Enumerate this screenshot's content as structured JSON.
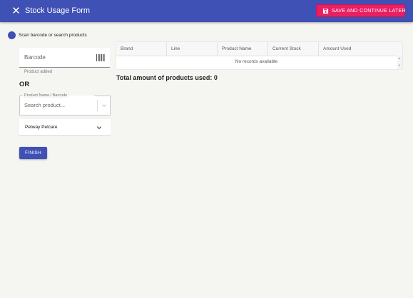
{
  "header": {
    "title": "Stock Usage Form",
    "save_label": "SAVE AND CONTINUE LATER"
  },
  "step": {
    "label": "Scan barcode or search products"
  },
  "barcode": {
    "placeholder": "Barcode",
    "helper": "Product added"
  },
  "or_label": "OR",
  "search": {
    "label": "Product Name / Barcode",
    "placeholder": "Search product..."
  },
  "location_select": {
    "value": "Petway Petcare"
  },
  "finish_label": "FINISH",
  "table": {
    "columns": [
      "Brand",
      "Line",
      "Product Name",
      "Current Stock",
      "Amount Used"
    ],
    "empty_message": "No records available"
  },
  "total_text": "Total amount of products used: 0",
  "colors": {
    "primary": "#3f51b5",
    "accent": "#e91e63",
    "background": "#f5f5f1"
  },
  "icons": [
    "close-icon",
    "save-icon",
    "barcode-icon",
    "chevron-down-icon"
  ]
}
